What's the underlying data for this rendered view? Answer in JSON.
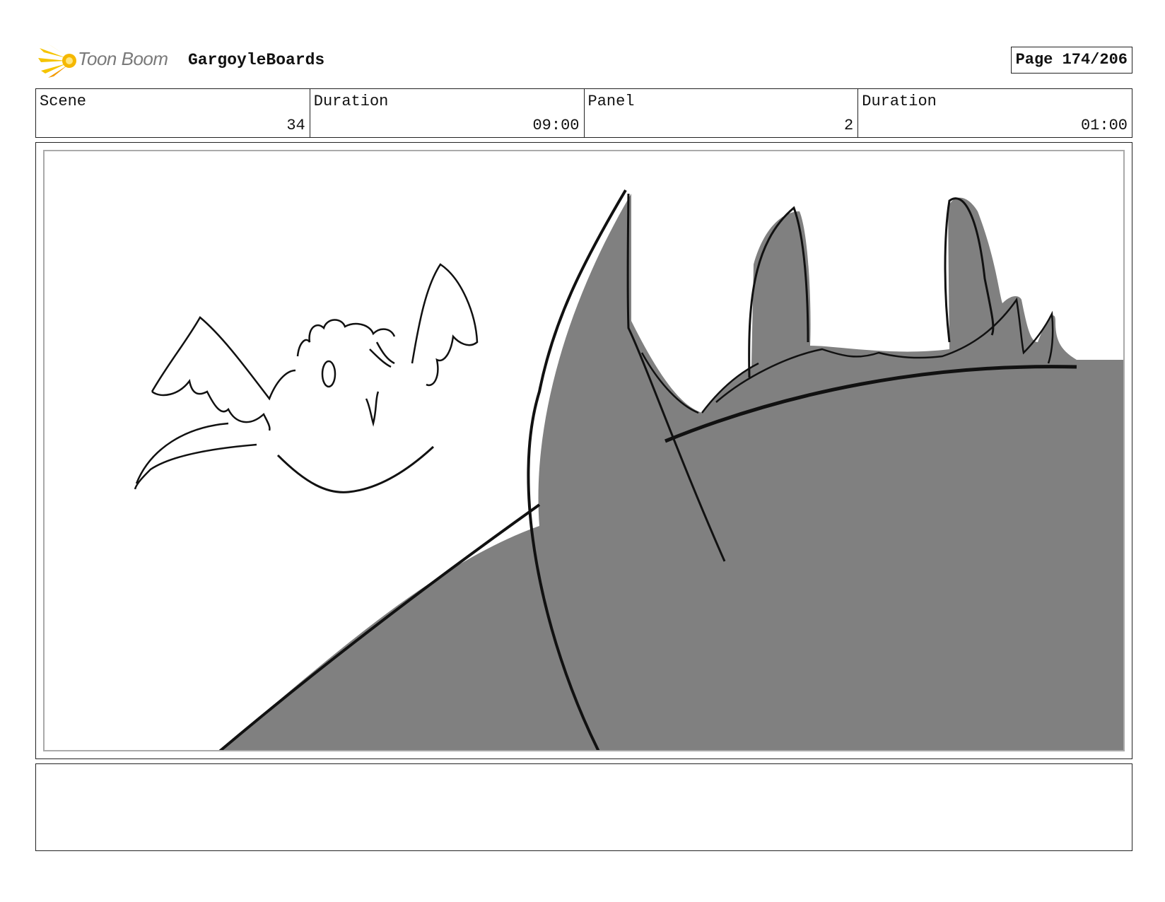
{
  "header": {
    "logo_text": "Toon Boom",
    "project_title": "GargoyleBoards",
    "page_label": "Page 174/206"
  },
  "info": {
    "scene_label": "Scene",
    "scene_value": "34",
    "scene_duration_label": "Duration",
    "scene_duration_value": "09:00",
    "panel_label": "Panel",
    "panel_value": "2",
    "panel_duration_label": "Duration",
    "panel_duration_value": "01:00"
  },
  "colors": {
    "logo_yellow": "#f5c400",
    "logo_orange": "#f39a00",
    "sketch_fill": "#808080",
    "sketch_line": "#111111"
  },
  "notes": {
    "text": ""
  }
}
